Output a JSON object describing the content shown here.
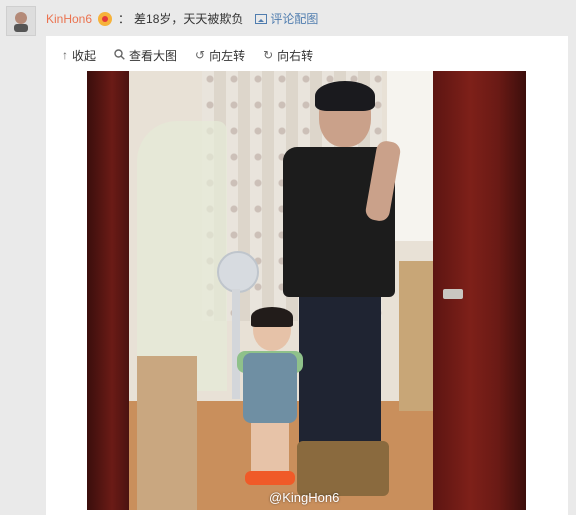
{
  "comment": {
    "username": "KinHon6",
    "colon": "：",
    "text": "差18岁，天天被欺负",
    "comment_pic_label": "评论配图"
  },
  "toolbar": {
    "collapse_label": "收起",
    "view_large_label": "查看大图",
    "rotate_left_label": "向左转",
    "rotate_right_label": "向右转"
  },
  "photo": {
    "watermark": "@KingHon6"
  },
  "icons": {
    "collapse": "arrow-up-icon",
    "view_large": "search-icon",
    "rotate_left": "rotate-left-icon",
    "rotate_right": "rotate-right-icon",
    "comment_pic": "image-icon",
    "badge": "vip-badge-icon"
  },
  "colors": {
    "username": "#eb7350",
    "link": "#507daf",
    "background": "#eaeaea",
    "card": "#ffffff"
  }
}
